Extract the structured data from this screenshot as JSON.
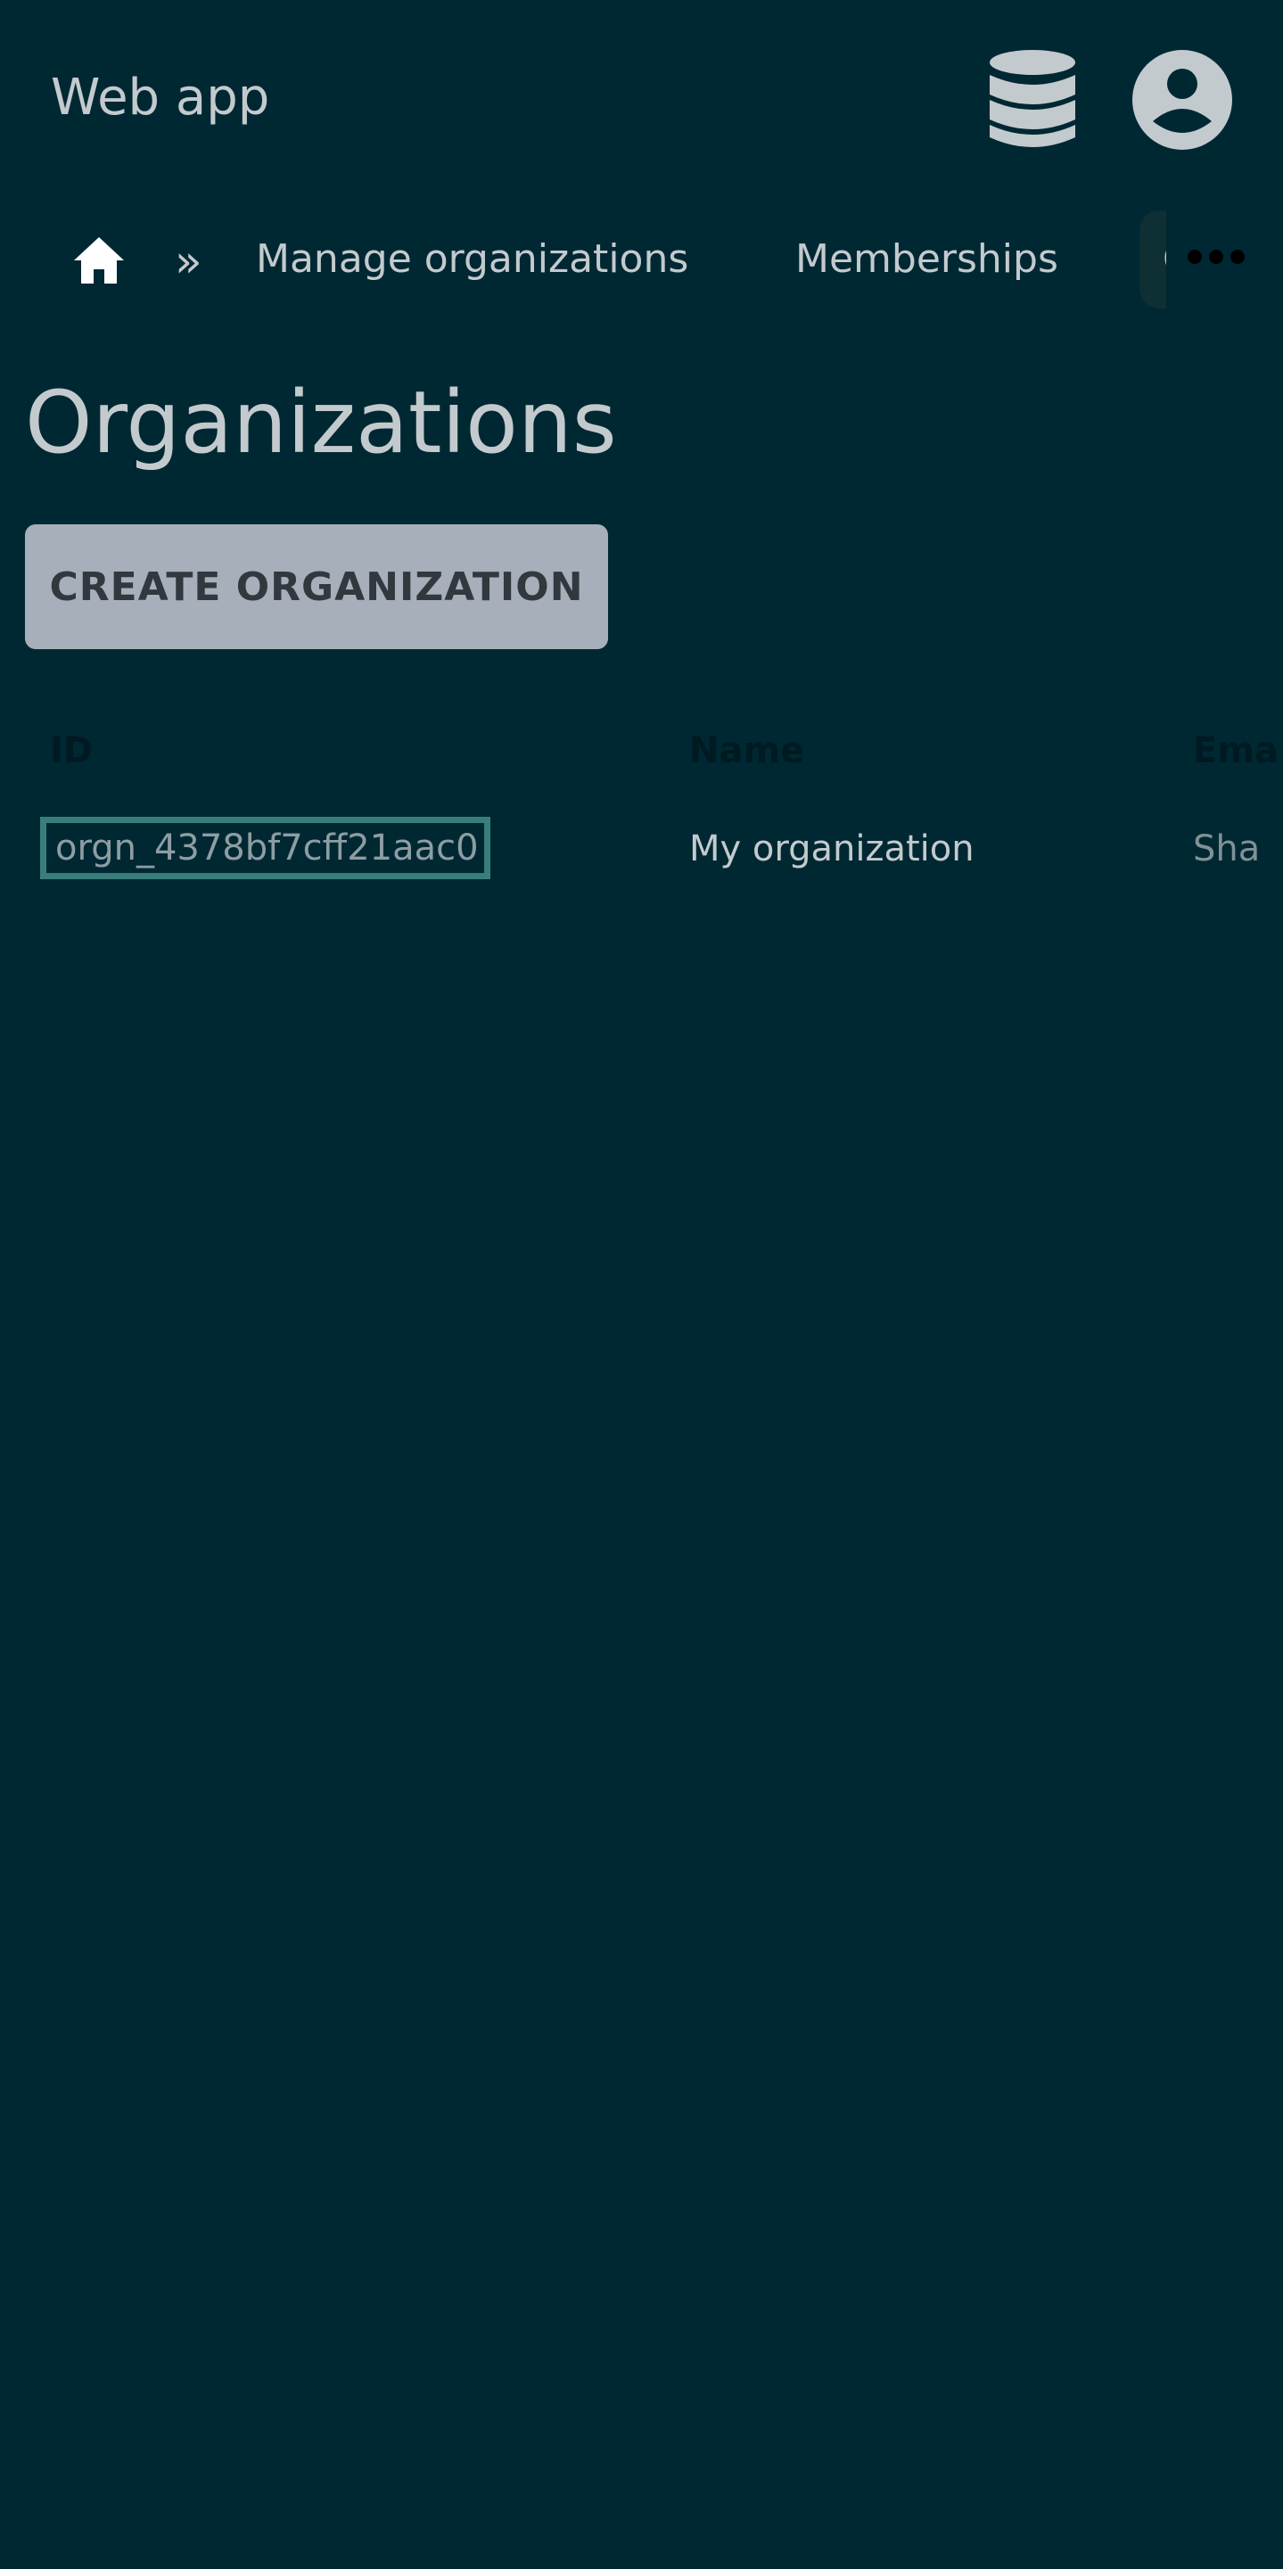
{
  "app": {
    "title": "Web app"
  },
  "header": {
    "database_icon": "database-icon",
    "account_icon": "account-circle-icon"
  },
  "nav": {
    "home_icon": "home-icon",
    "separator": "»",
    "items": [
      {
        "label": "Manage organizations"
      },
      {
        "label": "Memberships"
      },
      {
        "label": "O"
      }
    ],
    "more_icon": "more-horizontal-icon"
  },
  "page": {
    "title": "Organizations",
    "create_button_label": "CREATE ORGANIZATION"
  },
  "table": {
    "columns": [
      "ID",
      "Name",
      "Ema"
    ],
    "rows": [
      {
        "id": "orgn_4378bf7cff21aac0",
        "name": "My organization",
        "email": "Sha"
      }
    ]
  },
  "colors": {
    "background": "#002833",
    "text": "#c3cacd",
    "button_bg": "#a7b0ba",
    "button_text": "#31393f",
    "focus_outline": "#3a7e7c"
  }
}
